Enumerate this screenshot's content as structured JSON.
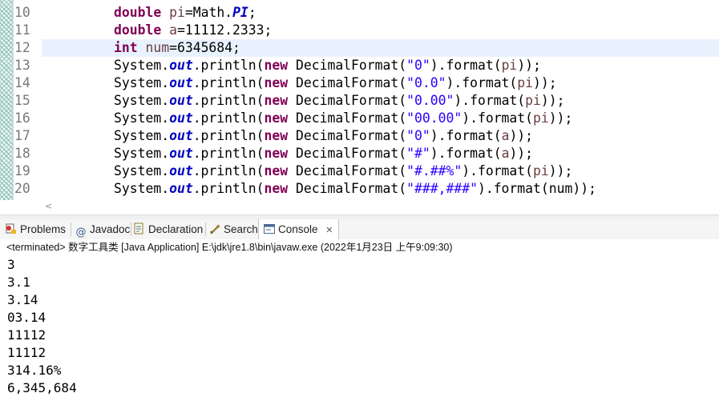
{
  "editor": {
    "lines": [
      {
        "num": "10",
        "segments": [
          {
            "t": "double",
            "c": "kw"
          },
          {
            "t": " "
          },
          {
            "t": "pi",
            "c": "var"
          },
          {
            "t": "=Math."
          },
          {
            "t": "PI",
            "c": "fld"
          },
          {
            "t": ";"
          }
        ]
      },
      {
        "num": "11",
        "segments": [
          {
            "t": "double",
            "c": "kw"
          },
          {
            "t": " "
          },
          {
            "t": "a",
            "c": "var"
          },
          {
            "t": "=11112.2333;"
          }
        ]
      },
      {
        "num": "12",
        "segments": [
          {
            "t": "int",
            "c": "kw"
          },
          {
            "t": " "
          },
          {
            "t": "num",
            "c": "var"
          },
          {
            "t": "=6345684;"
          }
        ],
        "current": true
      },
      {
        "num": "13",
        "segments": [
          {
            "t": "System."
          },
          {
            "t": "out",
            "c": "fld"
          },
          {
            "t": ".println("
          },
          {
            "t": "new",
            "c": "kw"
          },
          {
            "t": " DecimalFormat("
          },
          {
            "t": "\"0\"",
            "c": "str"
          },
          {
            "t": ").format("
          },
          {
            "t": "pi",
            "c": "var"
          },
          {
            "t": "));"
          }
        ]
      },
      {
        "num": "14",
        "segments": [
          {
            "t": "System."
          },
          {
            "t": "out",
            "c": "fld"
          },
          {
            "t": ".println("
          },
          {
            "t": "new",
            "c": "kw"
          },
          {
            "t": " DecimalFormat("
          },
          {
            "t": "\"0.0\"",
            "c": "str"
          },
          {
            "t": ").format("
          },
          {
            "t": "pi",
            "c": "var"
          },
          {
            "t": "));"
          }
        ]
      },
      {
        "num": "15",
        "segments": [
          {
            "t": "System."
          },
          {
            "t": "out",
            "c": "fld"
          },
          {
            "t": ".println("
          },
          {
            "t": "new",
            "c": "kw"
          },
          {
            "t": " DecimalFormat("
          },
          {
            "t": "\"0.00\"",
            "c": "str"
          },
          {
            "t": ").format("
          },
          {
            "t": "pi",
            "c": "var"
          },
          {
            "t": "));"
          }
        ]
      },
      {
        "num": "16",
        "segments": [
          {
            "t": "System."
          },
          {
            "t": "out",
            "c": "fld"
          },
          {
            "t": ".println("
          },
          {
            "t": "new",
            "c": "kw"
          },
          {
            "t": " DecimalFormat("
          },
          {
            "t": "\"00.00\"",
            "c": "str"
          },
          {
            "t": ").format("
          },
          {
            "t": "pi",
            "c": "var"
          },
          {
            "t": "));"
          }
        ]
      },
      {
        "num": "17",
        "segments": [
          {
            "t": "System."
          },
          {
            "t": "out",
            "c": "fld"
          },
          {
            "t": ".println("
          },
          {
            "t": "new",
            "c": "kw"
          },
          {
            "t": " DecimalFormat("
          },
          {
            "t": "\"0\"",
            "c": "str"
          },
          {
            "t": ").format("
          },
          {
            "t": "a",
            "c": "var"
          },
          {
            "t": "));"
          }
        ]
      },
      {
        "num": "18",
        "segments": [
          {
            "t": "System."
          },
          {
            "t": "out",
            "c": "fld"
          },
          {
            "t": ".println("
          },
          {
            "t": "new",
            "c": "kw"
          },
          {
            "t": " DecimalFormat("
          },
          {
            "t": "\"#\"",
            "c": "str"
          },
          {
            "t": ").format("
          },
          {
            "t": "a",
            "c": "var"
          },
          {
            "t": "));"
          }
        ]
      },
      {
        "num": "19",
        "segments": [
          {
            "t": "System."
          },
          {
            "t": "out",
            "c": "fld"
          },
          {
            "t": ".println("
          },
          {
            "t": "new",
            "c": "kw"
          },
          {
            "t": " DecimalFormat("
          },
          {
            "t": "\"#.##%\"",
            "c": "str"
          },
          {
            "t": ").format("
          },
          {
            "t": "pi",
            "c": "var"
          },
          {
            "t": "));"
          }
        ]
      },
      {
        "num": "20",
        "segments": [
          {
            "t": "System."
          },
          {
            "t": "out",
            "c": "fld"
          },
          {
            "t": ".println("
          },
          {
            "t": "new",
            "c": "kw"
          },
          {
            "t": " DecimalFormat("
          },
          {
            "t": "\"###,###\"",
            "c": "str"
          },
          {
            "t": ").format(num));"
          }
        ]
      }
    ],
    "scroll_left_arrow": "<"
  },
  "tabs": [
    {
      "label": "Problems",
      "icon": "problems-icon"
    },
    {
      "label": "Javadoc",
      "icon": "javadoc-icon"
    },
    {
      "label": "Declaration",
      "icon": "declaration-icon"
    },
    {
      "label": "Search",
      "icon": "search-icon"
    },
    {
      "label": "Console",
      "icon": "console-icon",
      "active": true,
      "close": "✕"
    }
  ],
  "console": {
    "status": "<terminated> 数字工具类 [Java Application] E:\\jdk\\jre1.8\\bin\\javaw.exe (2022年1月23日 上午9:09:30)",
    "output": [
      "3",
      "3.1",
      "3.14",
      "03.14",
      "11112",
      "11112",
      "314.16%",
      "6,345,684"
    ]
  },
  "colors": {
    "keyword": "#7f0055",
    "field": "#0000c0",
    "string": "#2a00ff",
    "local_var": "#6a3e3e",
    "current_line": "#e8f2fe"
  }
}
